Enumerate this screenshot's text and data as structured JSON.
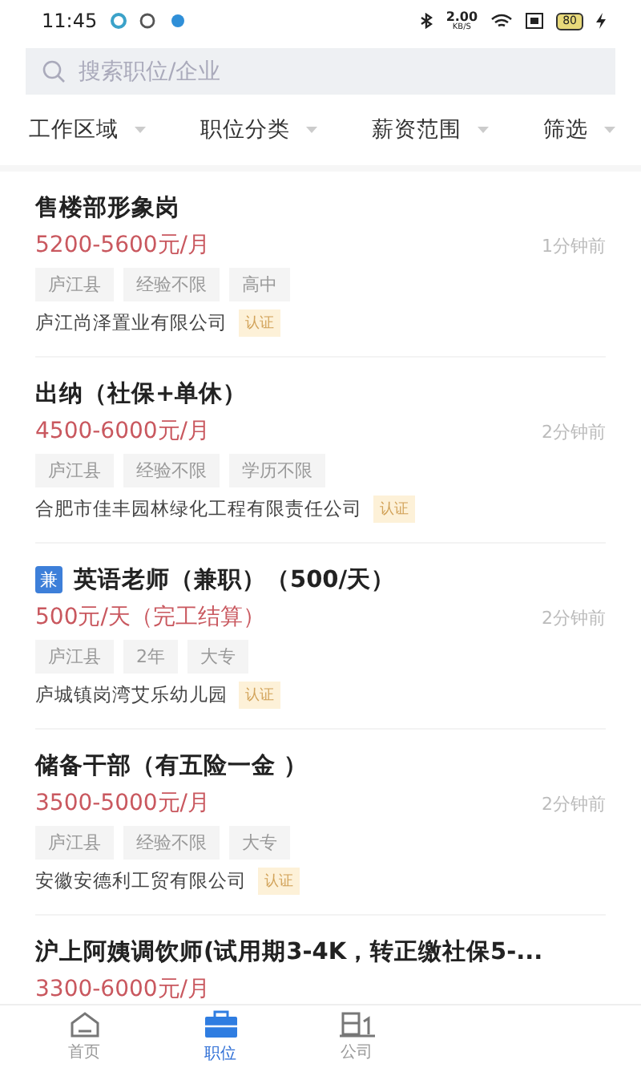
{
  "status_bar": {
    "time": "11:45",
    "speed_value": "2.00",
    "speed_unit": "KB/S",
    "battery": "80"
  },
  "search": {
    "placeholder": "搜索职位/企业"
  },
  "filters": [
    {
      "label": "工作区域"
    },
    {
      "label": "职位分类"
    },
    {
      "label": "薪资范围"
    },
    {
      "label": "筛选"
    }
  ],
  "jobs": [
    {
      "title": "售楼部形象岗",
      "salary": "5200-5600元/月",
      "time": "1分钟前",
      "tags": [
        "庐江县",
        "经验不限",
        "高中"
      ],
      "company": "庐江尚泽置业有限公司",
      "verified_label": "认证"
    },
    {
      "title": "出纳（社保+单休）",
      "salary": "4500-6000元/月",
      "time": "2分钟前",
      "tags": [
        "庐江县",
        "经验不限",
        "学历不限"
      ],
      "company": "合肥市佳丰园林绿化工程有限责任公司",
      "verified_label": "认证"
    },
    {
      "badge": "兼",
      "title": "英语老师（兼职）（500/天）",
      "salary": "500元/天（完工结算）",
      "time": "2分钟前",
      "tags": [
        "庐江县",
        "2年",
        "大专"
      ],
      "company": "庐城镇岗湾艾乐幼儿园",
      "verified_label": "认证"
    },
    {
      "title": "储备干部（有五险一金 ）",
      "salary": "3500-5000元/月",
      "time": "2分钟前",
      "tags": [
        "庐江县",
        "经验不限",
        "大专"
      ],
      "company": "安徽安德利工贸有限公司",
      "verified_label": "认证"
    },
    {
      "title": "沪上阿姨调饮师(试用期3-4K，转正缴社保5-...",
      "salary": "3300-6000元/月"
    }
  ],
  "tab_bar": [
    {
      "kind": "home",
      "label": "首页",
      "selected": false
    },
    {
      "kind": "briefcase",
      "label": "职位",
      "selected": true
    },
    {
      "kind": "company",
      "label": "公司",
      "selected": false
    }
  ]
}
